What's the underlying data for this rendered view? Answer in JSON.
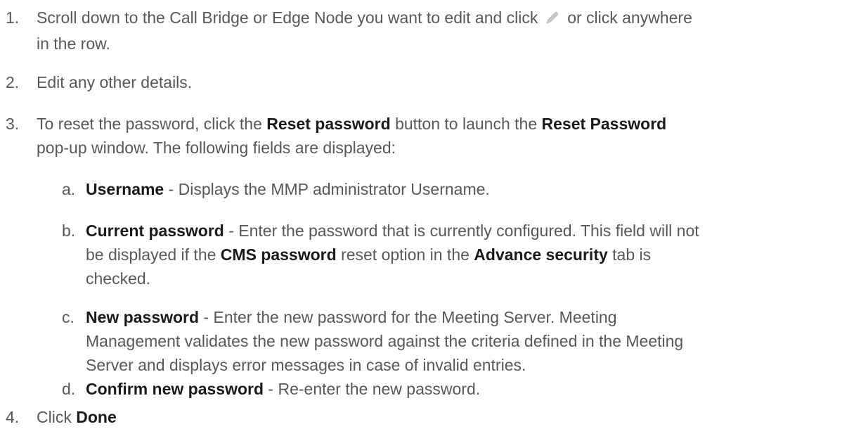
{
  "steps": [
    {
      "num": "1.",
      "text_before": "Scroll down to the Call Bridge or Edge Node you want to edit and click",
      "icon": "pencil-icon",
      "text_after1": "or click anywhere",
      "text_after2": "in the row."
    },
    {
      "num": "2.",
      "text": "Edit any other details."
    },
    {
      "num": "3.",
      "t1": "To reset the password, click the",
      "b1": "Reset password",
      "t2": "button to launch the",
      "b2": "Reset Password",
      "t3": "pop-up window. The following fields are displayed:"
    },
    {
      "num": "4.",
      "t1": "Click",
      "b1": "Done"
    }
  ],
  "substeps": [
    {
      "num": "a.",
      "bold": "Username",
      "text": " - Displays the MMP administrator Username."
    },
    {
      "num": "b.",
      "bold": "Current password",
      "t1": " - Enter the password that is currently configured. This field will not",
      "t2": "be displayed if the",
      "b2": "CMS password",
      "t3": "reset option in the",
      "b3": "Advance security",
      "t4": "tab is",
      "t5": "checked."
    },
    {
      "num": "c.",
      "bold": "New password",
      "t1": " - Enter the new password for the Meeting Server. Meeting",
      "t2": "Management validates the new password against the criteria defined in the Meeting",
      "t3": "Server and displays error messages in case of invalid entries."
    },
    {
      "num": "d.",
      "bold": "Confirm new password",
      "text": " - Re-enter the new password."
    }
  ]
}
